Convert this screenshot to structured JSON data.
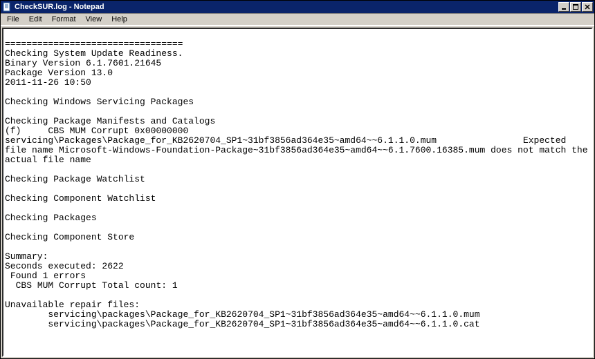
{
  "window": {
    "title": "CheckSUR.log - Notepad"
  },
  "menubar": {
    "items": [
      "File",
      "Edit",
      "Format",
      "View",
      "Help"
    ]
  },
  "document": {
    "lines": [
      "",
      "=================================",
      "Checking System Update Readiness.",
      "Binary Version 6.1.7601.21645",
      "Package Version 13.0",
      "2011-11-26 10:50",
      "",
      "Checking Windows Servicing Packages",
      "",
      "Checking Package Manifests and Catalogs",
      "(f)\tCBS MUM Corrupt\t0x00000000\tservicing\\Packages\\Package_for_KB2620704_SP1~31bf3856ad364e35~amd64~~6.1.1.0.mum\t\tExpected file name Microsoft-Windows-Foundation-Package~31bf3856ad364e35~amd64~~6.1.7600.16385.mum does not match the actual file name",
      "",
      "Checking Package Watchlist",
      "",
      "Checking Component Watchlist",
      "",
      "Checking Packages",
      "",
      "Checking Component Store",
      "",
      "Summary:",
      "Seconds executed: 2622",
      " Found 1 errors",
      "  CBS MUM Corrupt Total count: 1",
      "",
      "Unavailable repair files:",
      "\tservicing\\packages\\Package_for_KB2620704_SP1~31bf3856ad364e35~amd64~~6.1.1.0.mum",
      "\tservicing\\packages\\Package_for_KB2620704_SP1~31bf3856ad364e35~amd64~~6.1.1.0.cat",
      ""
    ]
  },
  "controls": {
    "minimize_glyph": "_",
    "maximize_glyph": "❐",
    "close_glyph": "✕"
  }
}
